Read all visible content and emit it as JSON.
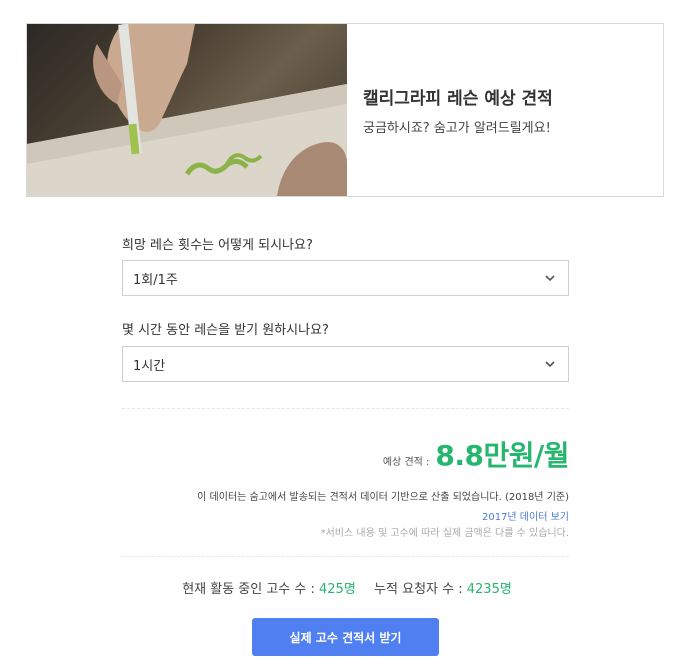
{
  "hero": {
    "title": "캘리그라피 레슨 예상 견적",
    "subtitle": "궁금하시죠? 숨고가 알려드릴게요!"
  },
  "form": {
    "frequency_label": "희망 레슨 횟수는 어떻게 되시나요?",
    "frequency_value": "1회/1주",
    "duration_label": "몇 시간 동안 레슨을 받기 원하시나요?",
    "duration_value": "1시간"
  },
  "estimate": {
    "label": "예상 견적 :",
    "value": "8.8만원/월"
  },
  "notes": {
    "source": "이 데이터는 숨고에서 발송되는 견적서 데이터 기반으로 산출 되었습니다. (2018년 기준)",
    "link_2017": "2017년 데이터 보기",
    "disclaimer": "*서비스 내용 및 고수에 따라 실제 금액은 다를 수 있습니다."
  },
  "stats": {
    "active_label": "현재 활동 중인 고수 수 :",
    "active_value": "425명",
    "requests_label": "누적 요청자 수 :",
    "requests_value": "4235명"
  },
  "cta": {
    "label": "실제 고수 견적서 받기"
  },
  "colors": {
    "accent_green": "#27b66f",
    "button_blue": "#4f7ff0",
    "link_blue": "#4a7bd8"
  },
  "icons": {
    "select_chevron": "chevron-down-icon"
  }
}
